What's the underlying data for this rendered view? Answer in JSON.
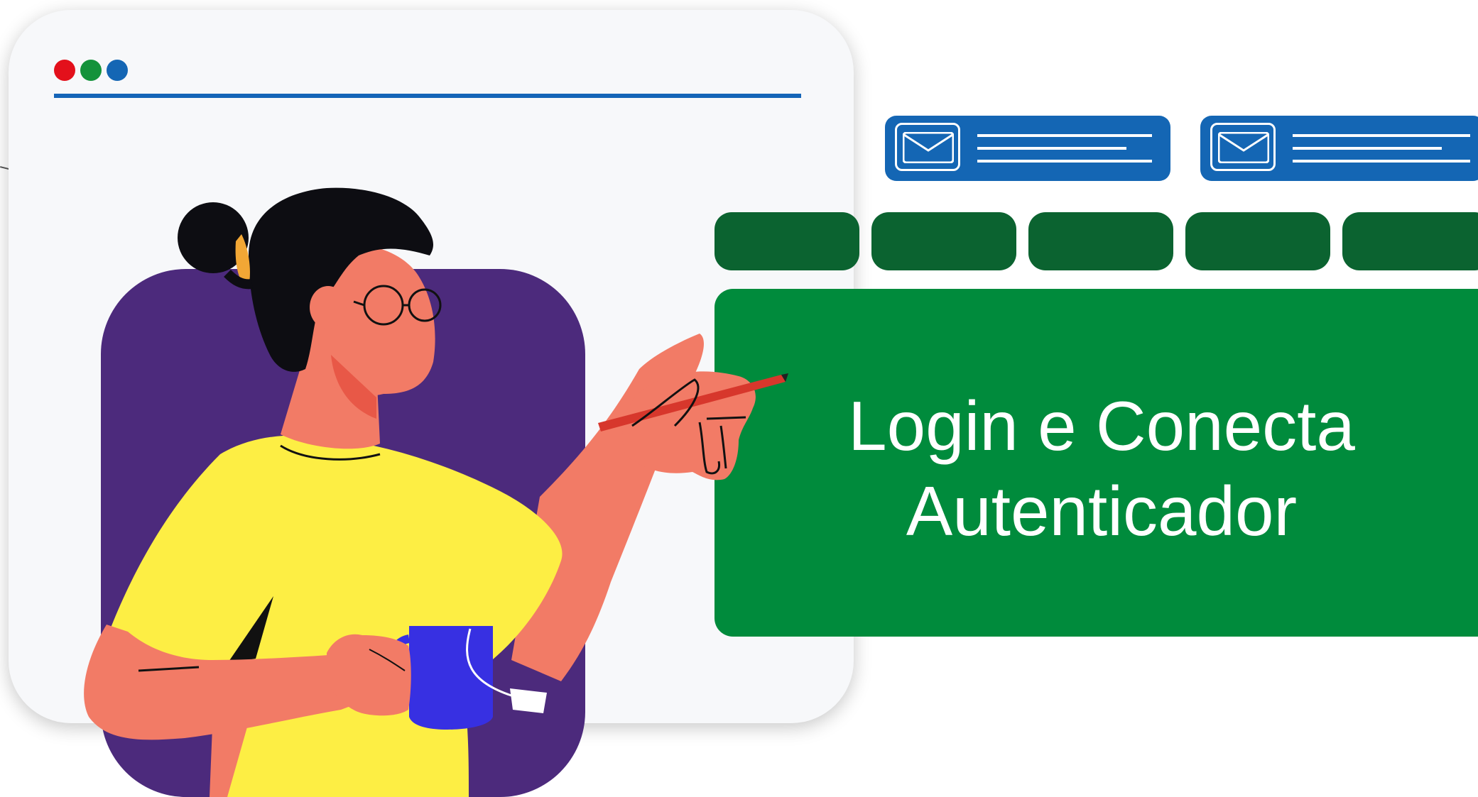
{
  "illustration": {
    "title_line1": "Login e Conecta",
    "title_line2": "Autenticador",
    "window_dots": [
      {
        "name": "red-dot",
        "color": "#e3101b"
      },
      {
        "name": "green-dot",
        "color": "#14923b"
      },
      {
        "name": "blue-dot",
        "color": "#1466b4"
      }
    ],
    "colors": {
      "accent_blue": "#1466b4",
      "dark_green": "#0b6330",
      "main_green": "#008b3c",
      "purple": "#4c2a7c",
      "shirt_yellow": "#fdee44",
      "skin": "#f27b66",
      "mug_blue": "#3730e2"
    },
    "icons": [
      "envelope-icon",
      "envelope-icon"
    ]
  }
}
